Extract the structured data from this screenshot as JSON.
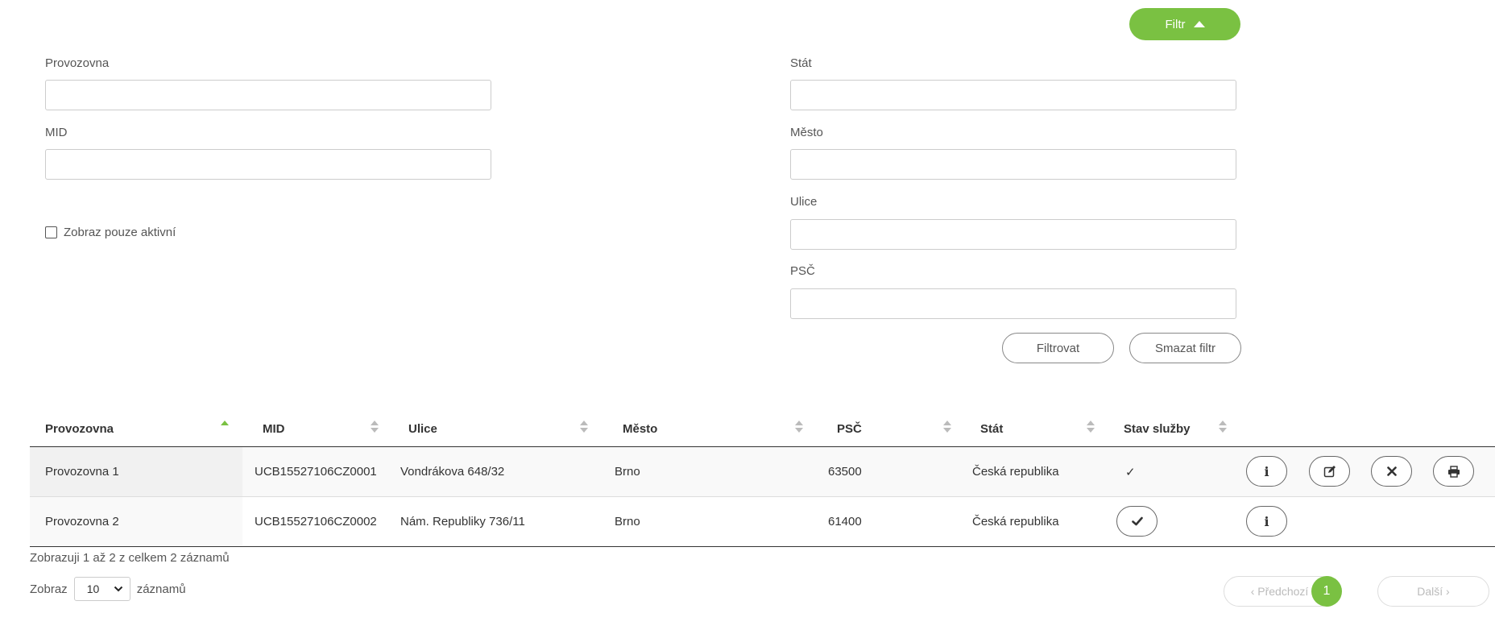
{
  "filter": {
    "toggle_label": "Filtr",
    "fields": {
      "provozovna": {
        "label": "Provozovna",
        "value": ""
      },
      "mid": {
        "label": "MID",
        "value": ""
      },
      "stat": {
        "label": "Stát",
        "value": ""
      },
      "mesto": {
        "label": "Město",
        "value": ""
      },
      "ulice": {
        "label": "Ulice",
        "value": ""
      },
      "psc": {
        "label": "PSČ",
        "value": ""
      }
    },
    "only_active": {
      "label": "Zobraz pouze aktivní",
      "checked": false
    },
    "apply_label": "Filtrovat",
    "clear_label": "Smazat filtr"
  },
  "table": {
    "columns": [
      "Provozovna",
      "MID",
      "Ulice",
      "Město",
      "PSČ",
      "Stát",
      "Stav služby"
    ],
    "sorted_column": "Provozovna",
    "sort_direction": "asc",
    "rows": [
      {
        "provozovna": "Provozovna 1",
        "mid": "UCB15527106CZ0001",
        "ulice": "Vondrákova 648/32",
        "mesto": "Brno",
        "psc": "63500",
        "stat": "Česká republika",
        "stav": "✓",
        "actions": [
          "info-icon",
          "edit-icon",
          "close-icon",
          "print-icon"
        ]
      },
      {
        "provozovna": "Provozovna 2",
        "mid": "UCB15527106CZ0002",
        "ulice": "Nám. Republiky 736/11",
        "mesto": "Brno",
        "psc": "61400",
        "stat": "Česká republika",
        "stav": "",
        "actions": [
          "check-icon",
          "info-icon"
        ]
      }
    ]
  },
  "footer": {
    "info": "Zobrazuji 1 až 2 z celkem 2 záznamů",
    "length_prefix": "Zobraz",
    "length_value": "10",
    "length_suffix": "záznamů",
    "prev_label": "‹ Předchozí",
    "current_page": "1",
    "next_label": "Další ›"
  },
  "colors": {
    "accent": "#7ac142",
    "text": "#333333",
    "border": "#cccccc"
  }
}
